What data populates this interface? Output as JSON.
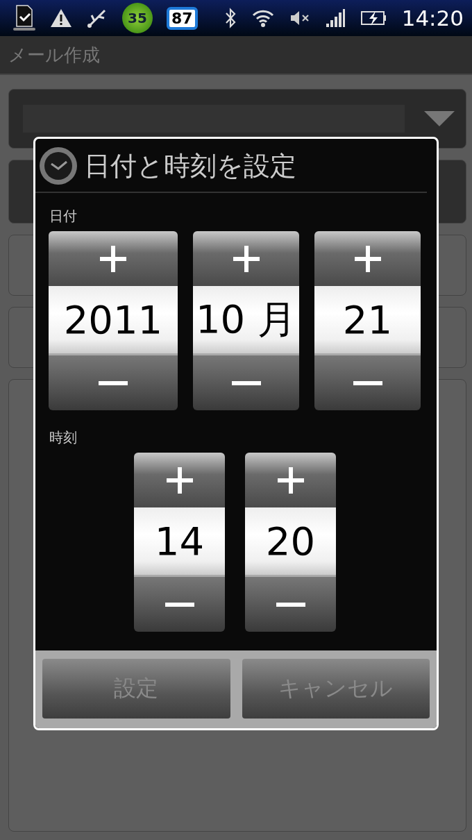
{
  "status_bar": {
    "badges": [
      {
        "kind": "timer",
        "text": "35"
      },
      {
        "kind": "battery",
        "text": "87"
      }
    ],
    "time": "14:20"
  },
  "app_bar": {
    "title": "メール作成"
  },
  "dialog": {
    "title": "日付と時刻を設定",
    "date_label": "日付",
    "date_fields": [
      {
        "value": "2011"
      },
      {
        "value": "10 月"
      },
      {
        "value": "21"
      }
    ],
    "time_label": "時刻",
    "time_fields": [
      {
        "value": "14"
      },
      {
        "value": "20"
      }
    ],
    "buttons": [
      "設定",
      "キャンセル"
    ]
  }
}
